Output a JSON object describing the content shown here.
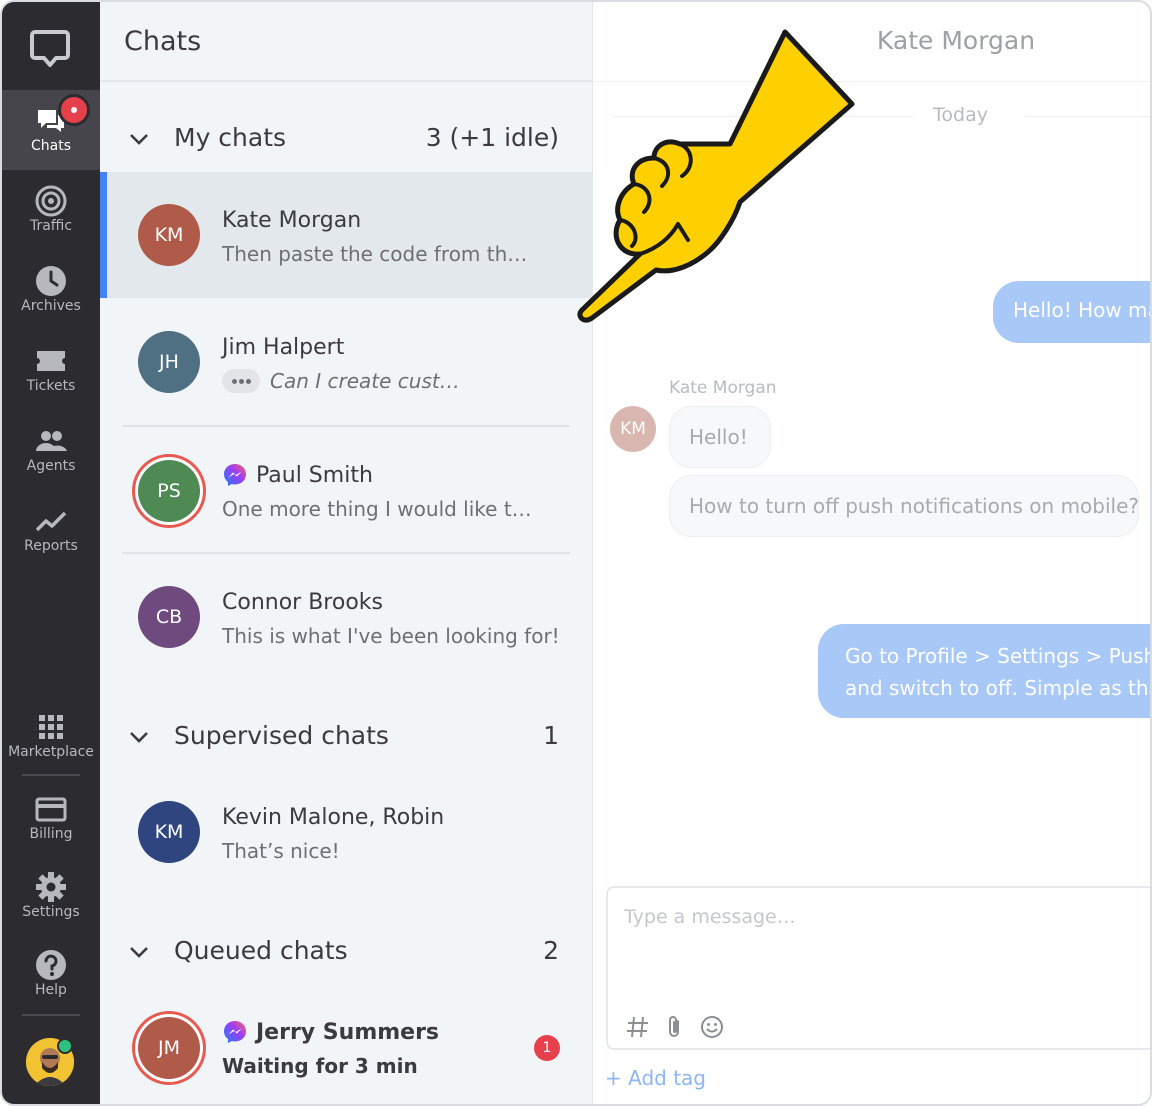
{
  "nav": {
    "items": [
      {
        "label": "Chats",
        "icon": "chats-icon",
        "active": true
      },
      {
        "label": "Traffic",
        "icon": "traffic-icon"
      },
      {
        "label": "Archives",
        "icon": "clock-icon"
      },
      {
        "label": "Tickets",
        "icon": "ticket-icon"
      },
      {
        "label": "Agents",
        "icon": "agents-icon"
      },
      {
        "label": "Reports",
        "icon": "chart-line-icon"
      },
      {
        "label": "Marketplace",
        "icon": "grid-icon"
      },
      {
        "label": "Billing",
        "icon": "credit-card-icon"
      },
      {
        "label": "Settings",
        "icon": "gear-icon"
      },
      {
        "label": "Help",
        "icon": "help-icon"
      }
    ]
  },
  "list": {
    "title": "Chats",
    "sections": [
      {
        "name": "My chats",
        "count": "3 (+1 idle)"
      },
      {
        "name": "Supervised chats",
        "count": "1"
      },
      {
        "name": "Queued chats",
        "count": "2"
      }
    ],
    "chats": [
      {
        "initials": "KM",
        "name": "Kate Morgan",
        "preview": "Then paste the code from the e…",
        "color": "#b05a4a"
      },
      {
        "initials": "JH",
        "name": "Jim Halpert",
        "preview": "Can I create custom…",
        "color": "#4f6f82"
      },
      {
        "initials": "PS",
        "name": "Paul Smith",
        "preview": "One more thing I would like to a…",
        "color": "#4f8a55"
      },
      {
        "initials": "CB",
        "name": "Connor Brooks",
        "preview": "This is what I've been looking for!",
        "color": "#6e4a7e"
      },
      {
        "initials": "KM",
        "name": "Kevin Malone, Robin",
        "preview": "That’s nice!",
        "color": "#2e4580"
      },
      {
        "initials": "JM",
        "name": "Jerry Summers",
        "preview": "Waiting for 3 min",
        "color": "#b05a4a",
        "unread": "1"
      }
    ]
  },
  "conversation": {
    "title": "Kate Morgan",
    "date_label": "Today",
    "sender": "Kate Morgan",
    "sender_initials": "KM",
    "messages": {
      "out_1": "Hello! How ma",
      "in_1": "Hello!",
      "in_2": "How to turn off push notifications on mobile?",
      "out_2_line1": "Go to Profile > Settings > Push n",
      "out_2_line2": "and switch to off. Simple as that"
    },
    "composer_placeholder": "Type a message…",
    "add_tag": "+ Add tag"
  },
  "colors": {
    "accent": "#4383f5",
    "nav_bg": "#2c2b30",
    "pointer": "#ffd000"
  }
}
